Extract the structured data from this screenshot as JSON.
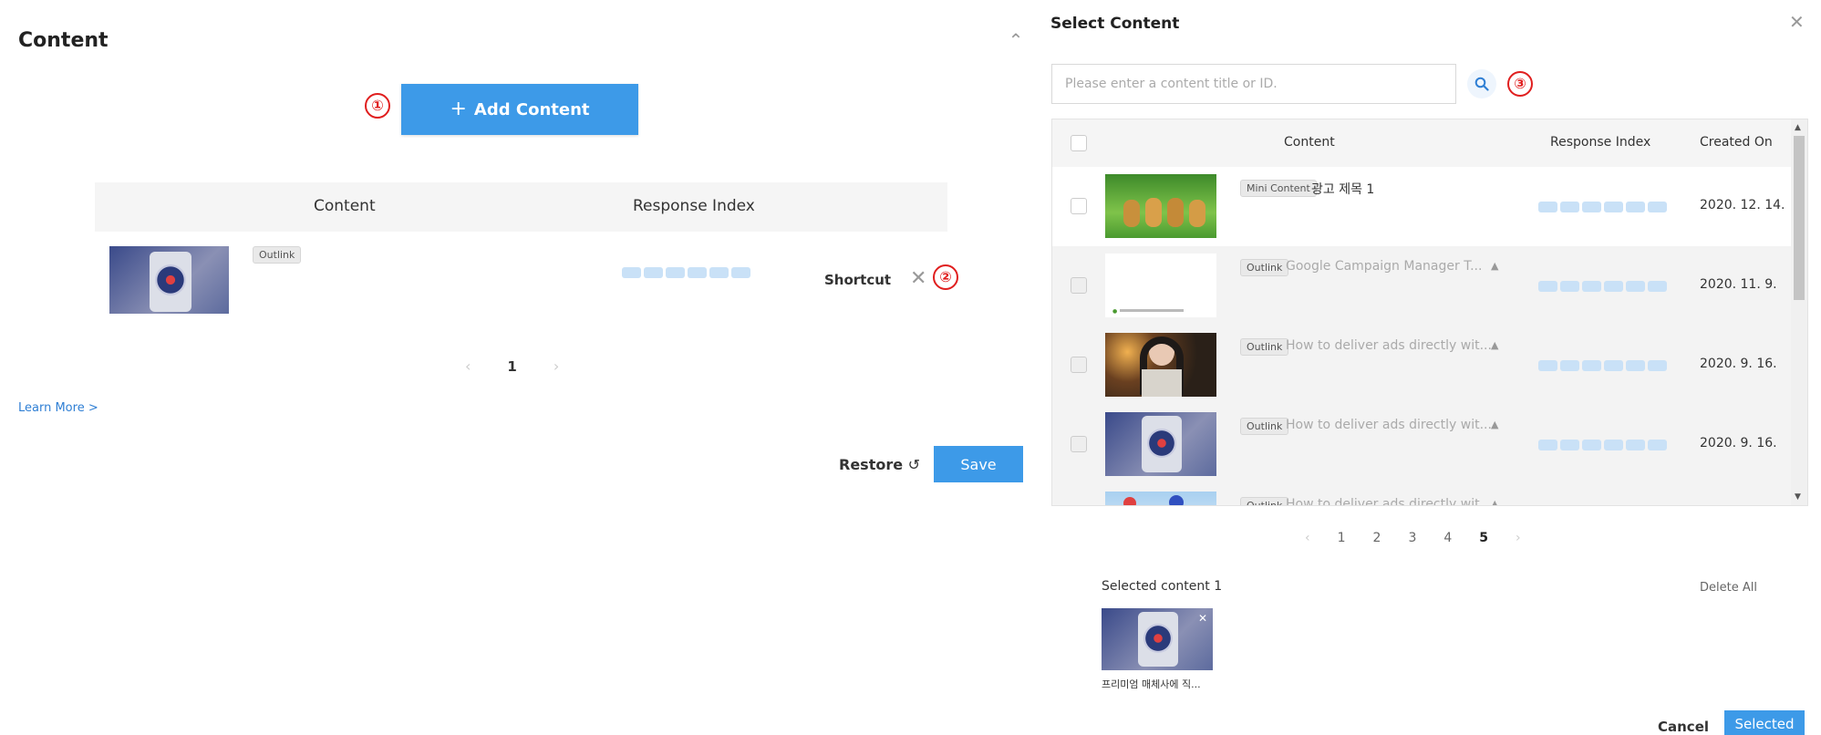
{
  "left": {
    "title": "Content",
    "add_button": "Add Content",
    "markers": [
      "①",
      "②",
      "③"
    ],
    "table": {
      "headers": [
        "Content",
        "Response Index"
      ],
      "row": {
        "tag": "Outlink",
        "shortcut": "Shortcut"
      }
    },
    "pager": {
      "current": "1"
    },
    "learn_more": "Learn More >",
    "restore": "Restore",
    "save": "Save"
  },
  "modal": {
    "title": "Select Content",
    "search_placeholder": "Please enter a content title or ID.",
    "table": {
      "headers": [
        "Content",
        "Response Index",
        "Created On"
      ],
      "rows": [
        {
          "tag": "Mini Content",
          "title": "광고 제목 1",
          "date": "2020. 12. 14.",
          "warning": false
        },
        {
          "tag": "Outlink",
          "title": "Google Campaign Manager T...",
          "date": "2020. 11. 9.",
          "warning": true
        },
        {
          "tag": "Outlink",
          "title": "How to deliver ads directly wit...",
          "date": "2020. 9. 16.",
          "warning": true
        },
        {
          "tag": "Outlink",
          "title": "How to deliver ads directly wit...",
          "date": "2020. 9. 16.",
          "warning": true
        },
        {
          "tag": "Outlink",
          "title": "How to deliver ads directly wit...",
          "date": "",
          "warning": true
        }
      ]
    },
    "pager": [
      "1",
      "2",
      "3",
      "4",
      "5"
    ],
    "pager_current": "5",
    "selected_label": "Selected content 1",
    "delete_all": "Delete All",
    "selected_caption": "프리미엄 매체사에 직...",
    "cancel": "Cancel",
    "selected_button": "Selected"
  },
  "colors": {
    "primary": "#3d9ae8",
    "marker": "#e01e1e",
    "response_block": "#c9e1f7"
  },
  "icons": {
    "collapse": "chevron-up-icon",
    "close": "close-icon",
    "search": "search-icon",
    "restore": "refresh-icon",
    "warning": "warning-icon"
  }
}
